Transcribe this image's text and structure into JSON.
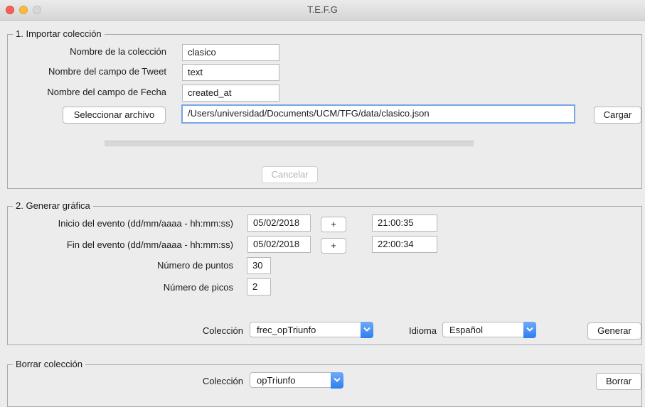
{
  "window": {
    "title": "T.E.F.G"
  },
  "import_section": {
    "legend": "1. Importar colección",
    "collection_name_label": "Nombre de la colección",
    "collection_name_value": "clasico",
    "tweet_field_label": "Nombre del campo de Tweet",
    "tweet_field_value": "text",
    "date_field_label": "Nombre del campo de Fecha",
    "date_field_value": "created_at",
    "select_file_button": "Seleccionar archivo",
    "file_path_value": "/Users/universidad/Documents/UCM/TFG/data/clasico.json",
    "load_button": "Cargar",
    "cancel_button": "Cancelar"
  },
  "graph_section": {
    "legend": "2. Generar gráfica",
    "event_start_label": "Inicio del evento (dd/mm/aaaa - hh:mm:ss)",
    "event_start_date": "05/02/2018",
    "event_start_time": "21:00:35",
    "event_end_label": "Fin del evento (dd/mm/aaaa - hh:mm:ss)",
    "event_end_date": "05/02/2018",
    "event_end_time": "22:00:34",
    "plus_label": "+",
    "points_label": "Número de puntos",
    "points_value": "30",
    "peaks_label": "Número de picos",
    "peaks_value": "2",
    "collection_label": "Colección",
    "collection_selected": "frec_opTriunfo",
    "language_label": "Idioma",
    "language_selected": "Español",
    "generate_button": "Generar"
  },
  "delete_section": {
    "legend": "Borrar colección",
    "collection_label": "Colección",
    "collection_selected": "opTriunfo",
    "delete_button": "Borrar"
  },
  "colors": {
    "focus": "#78a6e6",
    "select_arrow": "#2e7ef0",
    "close": "#fc605b",
    "minimize": "#fdbc40"
  }
}
